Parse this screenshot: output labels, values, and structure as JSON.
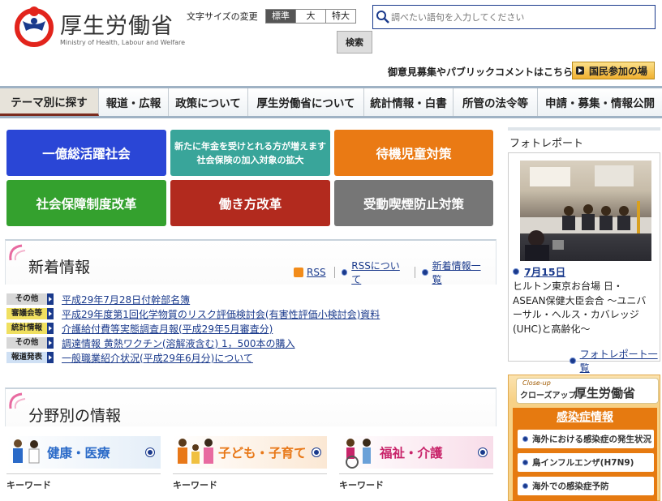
{
  "header": {
    "logo_title": "厚生労働省",
    "logo_subtitle": "Ministry of Health, Labour and Welfare",
    "font_size_label": "文字サイズの変更",
    "font_sizes": [
      "標準",
      "大",
      "特大"
    ],
    "search_placeholder": "調べたい語句を入力してください",
    "search_button": "検索",
    "public_comment": "御意見募集やパブリックコメントはこちら",
    "kokumin_button": "国民参加の場"
  },
  "nav": {
    "items": [
      "テーマ別に探す",
      "報道・広報",
      "政策について",
      "厚生労働省について",
      "統計情報・白書",
      "所管の法令等",
      "申請・募集・情報公開"
    ]
  },
  "tiles": [
    {
      "label": "一億総活躍社会",
      "color": "#2a46d6"
    },
    {
      "label": "新たに年金を受けとれる方が増えます",
      "label2": "社会保険の加入対象の拡大",
      "color": "#39a59a"
    },
    {
      "label": "待機児童対策",
      "color": "#ea7a14"
    },
    {
      "label": "社会保障制度改革",
      "color": "#34a12e"
    },
    {
      "label": "働き方改革",
      "color": "#b22a1e"
    },
    {
      "label": "受動喫煙防止対策",
      "color": "#767676"
    }
  ],
  "news": {
    "title": "新着情報",
    "rss": "RSS",
    "rss_about": "RSSについて",
    "news_list": "新着情報一覧",
    "items": [
      {
        "category": "その他",
        "text": "平成29年7月28日付幹部名簿"
      },
      {
        "category": "審議会等",
        "text": "平成29年度第1回化学物質のリスク評価検討会(有害性評価小検討会)資料"
      },
      {
        "category": "統計情報",
        "text": "介護給付費等実態調査月報(平成29年5月審査分)"
      },
      {
        "category": "その他",
        "text": "調達情報 黄熱ワクチン(溶解液含む) 1，500本の購入"
      },
      {
        "category": "報道発表",
        "text": "一般職業紹介状況(平成29年6月分)について"
      }
    ]
  },
  "fields": {
    "title": "分野別の情報",
    "items": [
      {
        "label": "健康・医療",
        "color": "#2a6ac8"
      },
      {
        "label": "子ども・子育て",
        "color": "#e87818"
      },
      {
        "label": "福祉・介護",
        "color": "#c8246a"
      }
    ],
    "keyword_label": "キーワード"
  },
  "photo_report": {
    "title": "フォトレポート",
    "date": "7月15日",
    "caption": "ヒルトン東京お台場 日・ASEAN保健大臣会合 〜ユニバーサル・ヘルス・カバレッジ(UHC)と高齢化〜",
    "all_link": "フォトレポート一覧"
  },
  "closeup": {
    "small": "Close-up",
    "jp": "クローズアップ",
    "big": "厚生労働省",
    "topic": "感染症情報",
    "links": [
      "海外における感染症の発生状況",
      "鳥インフルエンザ(H7N9)",
      "海外での感染症予防"
    ]
  }
}
